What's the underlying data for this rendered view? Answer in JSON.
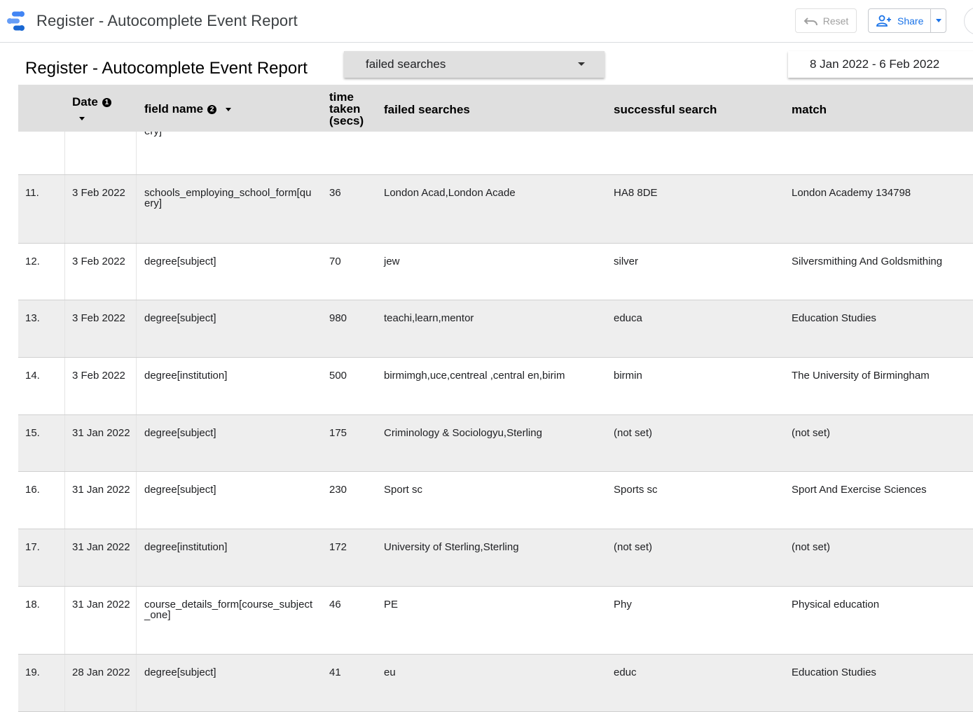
{
  "app": {
    "title": "Register - Autocomplete Event Report"
  },
  "toolbar": {
    "reset_label": "Reset",
    "share_label": "Share"
  },
  "report": {
    "title": "Register - Autocomplete Event Report",
    "filter_value": "failed searches",
    "date_range": "8 Jan 2022 - 6 Feb 2022"
  },
  "table": {
    "headers": {
      "date": "Date",
      "date_info": "1",
      "field": "field name",
      "field_info": "2",
      "time_line1": "time",
      "time_line2": "taken",
      "time_line3": "(secs)",
      "failed": "failed searches",
      "successful": "successful search",
      "match": "match"
    },
    "partial_row": {
      "field": "ery]"
    },
    "rows": [
      {
        "idx": "11.",
        "date": "3 Feb 2022",
        "field": "schools_employing_school_form[query]",
        "time": "36",
        "failed": "London Acad,London Acade",
        "successful": "HA8 8DE",
        "match": "London Academy 134798"
      },
      {
        "idx": "12.",
        "date": "3 Feb 2022",
        "field": "degree[subject]",
        "time": "70",
        "failed": "jew",
        "successful": "silver",
        "match": "Silversmithing And Goldsmithing"
      },
      {
        "idx": "13.",
        "date": "3 Feb 2022",
        "field": "degree[subject]",
        "time": "980",
        "failed": "teachi,learn,mentor",
        "successful": "educa",
        "match": "Education Studies"
      },
      {
        "idx": "14.",
        "date": "3 Feb 2022",
        "field": "degree[institution]",
        "time": "500",
        "failed": "birmimgh,uce,centreal ,central en,birim",
        "successful": "birmin",
        "match": "The University of Birmingham"
      },
      {
        "idx": "15.",
        "date": "31 Jan 2022",
        "field": "degree[subject]",
        "time": "175",
        "failed": "Criminology & Sociologyu,Sterling",
        "successful": "(not set)",
        "match": "(not set)"
      },
      {
        "idx": "16.",
        "date": "31 Jan 2022",
        "field": "degree[subject]",
        "time": "230",
        "failed": "Sport sc",
        "successful": "Sports sc",
        "match": "Sport And Exercise Sciences"
      },
      {
        "idx": "17.",
        "date": "31 Jan 2022",
        "field": "degree[institution]",
        "time": "172",
        "failed": "University of Sterling,Sterling",
        "successful": "(not set)",
        "match": "(not set)"
      },
      {
        "idx": "18.",
        "date": "31 Jan 2022",
        "field": "course_details_form[course_subject_one]",
        "time": "46",
        "failed": "PE",
        "successful": "Phy",
        "match": "Physical education"
      },
      {
        "idx": "19.",
        "date": "28 Jan 2022",
        "field": "degree[subject]",
        "time": "41",
        "failed": "eu",
        "successful": "educ",
        "match": "Education Studies"
      }
    ]
  }
}
